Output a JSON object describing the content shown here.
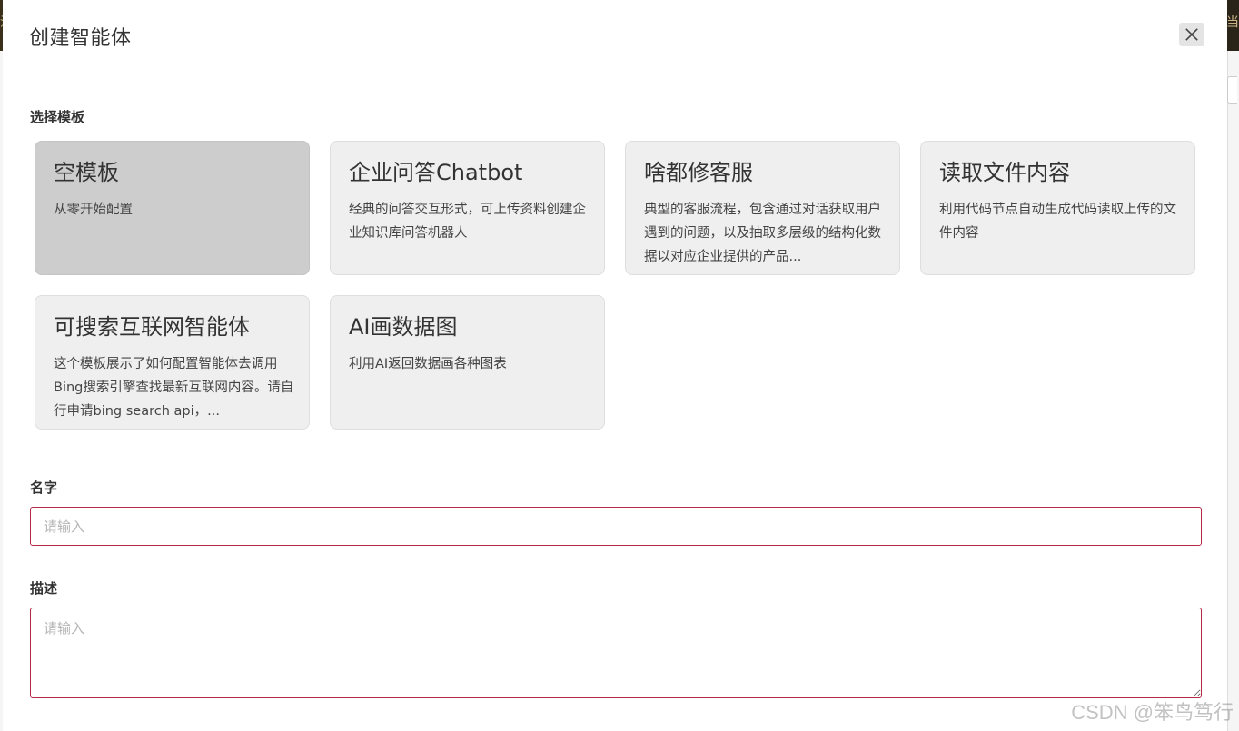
{
  "backdrop": {
    "left_glyph": "汐",
    "right_glyph": "当"
  },
  "modal": {
    "title": "创建智能体",
    "close_label": "×"
  },
  "templates": {
    "label": "选择模板",
    "items": [
      {
        "title": "空模板",
        "desc": "从零开始配置",
        "selected": true
      },
      {
        "title": "企业问答Chatbot",
        "desc": "经典的问答交互形式，可上传资料创建企业知识库问答机器人"
      },
      {
        "title": "啥都修客服",
        "desc": "典型的客服流程，包含通过对话获取用户遇到的问题，以及抽取多层级的结构化数据以对应企业提供的产品..."
      },
      {
        "title": "读取文件内容",
        "desc": "利用代码节点自动生成代码读取上传的文件内容"
      },
      {
        "title": "可搜索互联网智能体",
        "desc": "这个模板展示了如何配置智能体去调用Bing搜索引擎查找最新互联网内容。请自行申请bing search api，..."
      },
      {
        "title": "AI画数据图",
        "desc": "利用AI返回数据画各种图表"
      }
    ]
  },
  "name_field": {
    "label": "名字",
    "placeholder": "请输入",
    "value": ""
  },
  "desc_field": {
    "label": "描述",
    "placeholder": "请输入",
    "value": ""
  },
  "watermark": "CSDN @笨鸟笃行",
  "colors": {
    "field_border": "#b42a47",
    "card_bg": "#efefef",
    "card_selected_bg": "#cdcdcd"
  }
}
